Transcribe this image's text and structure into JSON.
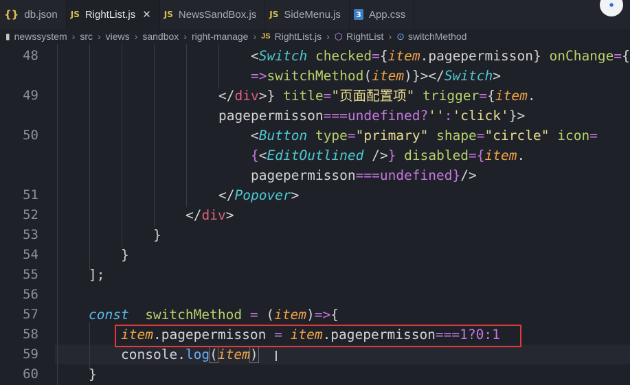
{
  "tabs": [
    {
      "icon": "json-icon",
      "glyph": "{}",
      "label": "db.json",
      "active": false,
      "kind": "json"
    },
    {
      "icon": "js-file-icon",
      "glyph": "JS",
      "label": "RightList.js",
      "active": true,
      "kind": "js",
      "close": "✕"
    },
    {
      "icon": "js-file-icon",
      "glyph": "JS",
      "label": "NewsSandBox.js",
      "active": false,
      "kind": "js"
    },
    {
      "icon": "js-file-icon",
      "glyph": "JS",
      "label": "SideMenu.js",
      "active": false,
      "kind": "js"
    },
    {
      "icon": "css-file-icon",
      "glyph": "3",
      "label": "App.css",
      "active": false,
      "kind": "css"
    }
  ],
  "breadcrumb": [
    "newssystem",
    "src",
    "views",
    "sandbox",
    "right-manage",
    "RightList.js",
    "RightList",
    "switchMethod"
  ],
  "lines": [
    {
      "num": "48",
      "indent": 365,
      "tokens": [
        [
          "<",
          "p"
        ],
        [
          "Switch",
          "c"
        ],
        [
          " ",
          "p"
        ],
        [
          "checked",
          "a"
        ],
        [
          "=",
          "o"
        ],
        [
          "{",
          "p"
        ],
        [
          "item",
          "k"
        ],
        [
          ".pagepermisson",
          "p"
        ],
        [
          "}",
          "p"
        ],
        [
          " ",
          "p"
        ],
        [
          "onChange",
          "a"
        ],
        [
          "=",
          "o"
        ],
        [
          "{",
          "p"
        ]
      ]
    },
    {
      "num": "",
      "indent": 365,
      "tokens": [
        [
          "=>",
          "o"
        ],
        [
          "switchMethod",
          "a"
        ],
        [
          "(",
          "p"
        ],
        [
          "item",
          "k"
        ],
        [
          ")",
          "p"
        ],
        [
          "}",
          "p"
        ],
        [
          "></",
          "p"
        ],
        [
          "Switch",
          "c"
        ],
        [
          ">",
          "p"
        ]
      ]
    },
    {
      "num": "49",
      "indent": 318,
      "tokens": [
        [
          "</",
          "p"
        ],
        [
          "div",
          "t"
        ],
        [
          ">",
          "p"
        ],
        [
          "}",
          "p"
        ],
        [
          " ",
          "p"
        ],
        [
          "title",
          "a"
        ],
        [
          "=",
          "o"
        ],
        [
          "\"页面配置项\"",
          "s"
        ],
        [
          " ",
          "p"
        ],
        [
          "trigger",
          "a"
        ],
        [
          "=",
          "o"
        ],
        [
          "{",
          "p"
        ],
        [
          "item",
          "k"
        ],
        [
          ".",
          "p"
        ]
      ]
    },
    {
      "num": "",
      "indent": 318,
      "tokens": [
        [
          "pagepermisson",
          "p"
        ],
        [
          "===",
          "o"
        ],
        [
          "undefined",
          "n"
        ],
        [
          "?",
          "o"
        ],
        [
          "''",
          "s"
        ],
        [
          ":",
          "o"
        ],
        [
          "'click'",
          "s"
        ],
        [
          "}",
          "p"
        ],
        [
          ">",
          "p"
        ]
      ]
    },
    {
      "num": "50",
      "indent": 365,
      "tokens": [
        [
          "<",
          "p"
        ],
        [
          "Button",
          "c"
        ],
        [
          " ",
          "p"
        ],
        [
          "type",
          "a"
        ],
        [
          "=",
          "o"
        ],
        [
          "\"primary\"",
          "s"
        ],
        [
          " ",
          "p"
        ],
        [
          "shape",
          "a"
        ],
        [
          "=",
          "o"
        ],
        [
          "\"circle\"",
          "s"
        ],
        [
          " ",
          "p"
        ],
        [
          "icon",
          "a"
        ],
        [
          "=",
          "o"
        ]
      ]
    },
    {
      "num": "",
      "indent": 365,
      "tokens": [
        [
          "{",
          "o"
        ],
        [
          "<",
          "p"
        ],
        [
          "EditOutlined",
          "c"
        ],
        [
          " />",
          "p"
        ],
        [
          "}",
          "o"
        ],
        [
          " ",
          "p"
        ],
        [
          "disabled",
          "a"
        ],
        [
          "=",
          "o"
        ],
        [
          "{",
          "o"
        ],
        [
          "item",
          "k"
        ],
        [
          ".",
          "p"
        ]
      ]
    },
    {
      "num": "",
      "indent": 365,
      "tokens": [
        [
          "pagepermisson",
          "p"
        ],
        [
          "===",
          "o"
        ],
        [
          "undefined",
          "n"
        ],
        [
          "}",
          "o"
        ],
        [
          "/>",
          "p"
        ]
      ]
    },
    {
      "num": "51",
      "indent": 318,
      "tokens": [
        [
          "</",
          "p"
        ],
        [
          "Popover",
          "c"
        ],
        [
          ">",
          "p"
        ]
      ]
    },
    {
      "num": "52",
      "indent": 270,
      "tokens": [
        [
          "</",
          "p"
        ],
        [
          "div",
          "t"
        ],
        [
          ">",
          "p"
        ]
      ]
    },
    {
      "num": "53",
      "indent": 223,
      "tokens": [
        [
          "}",
          "p"
        ]
      ]
    },
    {
      "num": "54",
      "indent": 176,
      "tokens": [
        [
          "}",
          "p"
        ]
      ]
    },
    {
      "num": "55",
      "indent": 129,
      "tokens": [
        [
          "];",
          "p"
        ]
      ]
    },
    {
      "num": "56",
      "indent": 129,
      "tokens": []
    },
    {
      "num": "57",
      "indent": 129,
      "tokens": [
        [
          "const",
          "kw"
        ],
        [
          "  ",
          "p"
        ],
        [
          "switchMethod",
          "a"
        ],
        [
          " ",
          "p"
        ],
        [
          "=",
          "o"
        ],
        [
          " ",
          "p"
        ],
        [
          "(",
          "p"
        ],
        [
          "item",
          "k"
        ],
        [
          ")",
          "p"
        ],
        [
          "=>",
          "o"
        ],
        [
          "{",
          "p"
        ]
      ]
    },
    {
      "num": "58",
      "indent": 176,
      "tokens": [
        [
          "item",
          "k"
        ],
        [
          ".pagepermisson",
          "p"
        ],
        [
          " ",
          "p"
        ],
        [
          "=",
          "o"
        ],
        [
          " ",
          "p"
        ],
        [
          "item",
          "k"
        ],
        [
          ".pagepermisson",
          "p"
        ],
        [
          "===",
          "o"
        ],
        [
          "1",
          "n"
        ],
        [
          "?",
          "o"
        ],
        [
          "0",
          "n"
        ],
        [
          ":",
          "o"
        ],
        [
          "1",
          "n"
        ]
      ]
    },
    {
      "num": "59",
      "indent": 176,
      "tokens": [
        [
          "console",
          "p"
        ],
        [
          ".",
          "p"
        ],
        [
          "log",
          "f"
        ],
        [
          "(",
          "bx"
        ],
        [
          "item",
          "k"
        ],
        [
          ")",
          "bx"
        ]
      ]
    },
    {
      "num": "60",
      "indent": 129,
      "tokens": [
        [
          "}",
          "p"
        ]
      ]
    }
  ]
}
